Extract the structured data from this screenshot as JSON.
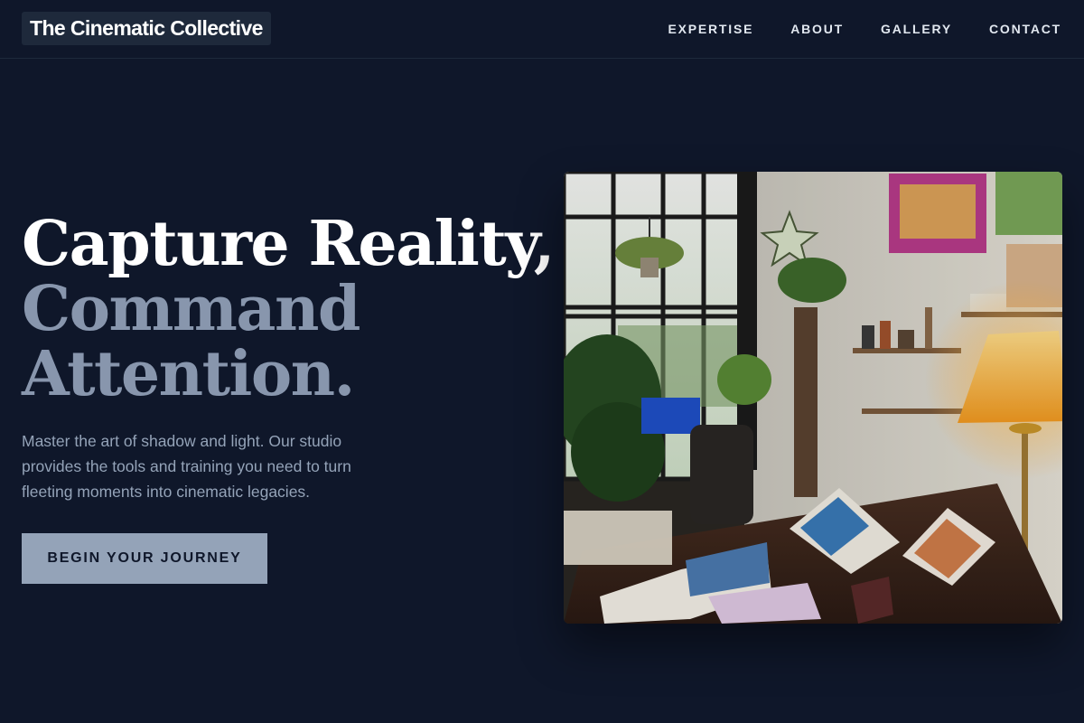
{
  "header": {
    "logo": "The Cinematic Collective",
    "nav": [
      "EXPERTISE",
      "ABOUT",
      "GALLERY",
      "CONTACT"
    ]
  },
  "hero": {
    "headline": [
      "Capture Reality,",
      "Command",
      "Attention."
    ],
    "subtext": "Master the art of shadow and light. Our studio provides the tools and training you need to turn fleeting moments into cinematic legacies.",
    "cta": "BEGIN YOUR JOURNEY",
    "image_alt": "Sunlit artist studio with plants, sketchbooks and a glowing lamp"
  },
  "colors": {
    "background": "#0f172a",
    "accent": "#94a3b8",
    "headline_primary": "#ffffff",
    "headline_muted": "#8896ad"
  }
}
